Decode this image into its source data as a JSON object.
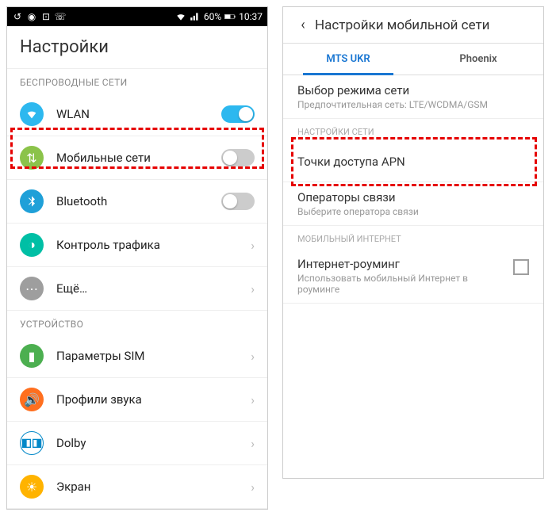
{
  "statusbar": {
    "battery_pct": "60%",
    "time": "10:37"
  },
  "left": {
    "header": "Настройки",
    "section_wireless": "БЕСПРОВОДНЫЕ СЕТИ",
    "section_device": "УСТРОЙСТВО",
    "items": {
      "wlan": "WLAN",
      "mobile": "Мобильные сети",
      "bluetooth": "Bluetooth",
      "traffic": "Контроль трафика",
      "more": "Ещё…",
      "sim": "Параметры SIM",
      "sound": "Профили звука",
      "dolby": "Dolby",
      "screen": "Экран"
    }
  },
  "right": {
    "title": "Настройки мобильной сети",
    "tabs": {
      "a": "MTS UKR",
      "b": "Phoenix"
    },
    "mode": {
      "title": "Выбор режима сети",
      "sub": "Предпочтительная сеть: LTE/WCDMA/GSM"
    },
    "section_net": "НАСТРОЙКИ СЕТИ",
    "apn": "Точки доступа APN",
    "operators": {
      "title": "Операторы связи",
      "sub": "Выберите оператора связи"
    },
    "section_inet": "МОБИЛЬНЫЙ ИНТЕРНЕТ",
    "roaming": {
      "title": "Интернет-роуминг",
      "sub": "Использовать мобильный Интернет в роуминге"
    }
  }
}
